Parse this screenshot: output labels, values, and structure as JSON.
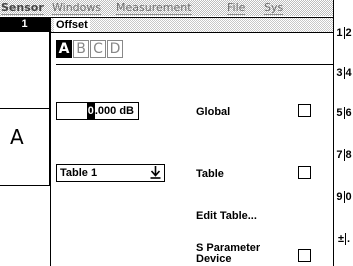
{
  "menubar": {
    "items": [
      "Sensor",
      "Windows",
      "Measurement",
      "File",
      "Sys"
    ]
  },
  "status_strip": {
    "channel": "1",
    "letter": "A"
  },
  "dialog": {
    "title": "Offset",
    "tabs": [
      "A",
      "B",
      "C",
      "D"
    ],
    "active_tab": "A",
    "offset_field": {
      "cursor_char": "0",
      "rest": ".000 dB"
    },
    "table_select": {
      "value": "Table 1"
    },
    "options": {
      "global_label": "Global",
      "table_label": "Table",
      "edit_table_label": "Edit Table...",
      "s_param_label_line1": "S Parameter",
      "s_param_label_line2": "Device"
    }
  },
  "softkeys": [
    {
      "top": "1",
      "bottom": "2"
    },
    {
      "top": "3",
      "bottom": "4"
    },
    {
      "top": "5",
      "bottom": "6"
    },
    {
      "top": "7",
      "bottom": "8"
    },
    {
      "top": "9",
      "bottom": "0"
    },
    {
      "top": "±",
      "bottom": "."
    }
  ],
  "icons": {
    "select_arrow": "download-arrow-icon"
  }
}
